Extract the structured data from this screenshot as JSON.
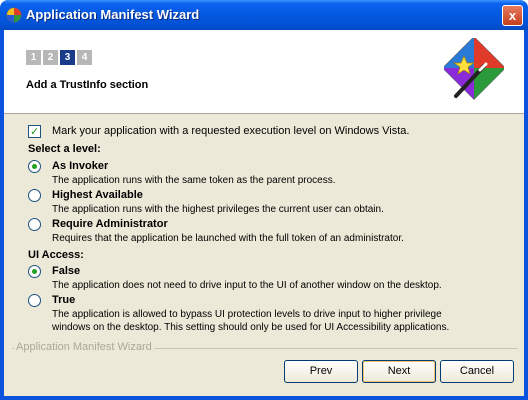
{
  "window": {
    "title": "Application Manifest Wizard",
    "close_label": "x"
  },
  "header": {
    "steps": [
      "1",
      "2",
      "3",
      "4"
    ],
    "active_step": 3,
    "title": "Add a TrustInfo section"
  },
  "trust": {
    "mark_label": "Mark your application with a requested execution level on Windows Vista.",
    "mark_checked": true
  },
  "level": {
    "heading": "Select a level:",
    "options": [
      {
        "label": "As Invoker",
        "desc": "The application runs with the same token as the parent process.",
        "checked": true
      },
      {
        "label": "Highest Available",
        "desc": "The application runs with the highest privileges the current user can obtain.",
        "checked": false
      },
      {
        "label": "Require Administrator",
        "desc": "Requires that the application be launched with the full token of an administrator.",
        "checked": false
      }
    ]
  },
  "ui_access": {
    "heading": "UI Access:",
    "options": [
      {
        "label": "False",
        "desc": "The application does not need to drive input to the UI of another window on the desktop.",
        "checked": true
      },
      {
        "label": "True",
        "desc_line1": "The application is allowed to bypass UI protection levels to drive input to higher privilege",
        "desc_line2": "windows on the desktop. This setting should only be used for UI Accessibility applications.",
        "checked": false
      }
    ]
  },
  "footer": {
    "group_label": "Application Manifest Wizard",
    "prev_label": "Prev",
    "next_label": "Next",
    "cancel_label": "Cancel"
  },
  "colors": {
    "titlebar": "#0559e0",
    "client": "#ece9d8",
    "check_green": "#21a121",
    "active_step": "#1a3a8a"
  }
}
